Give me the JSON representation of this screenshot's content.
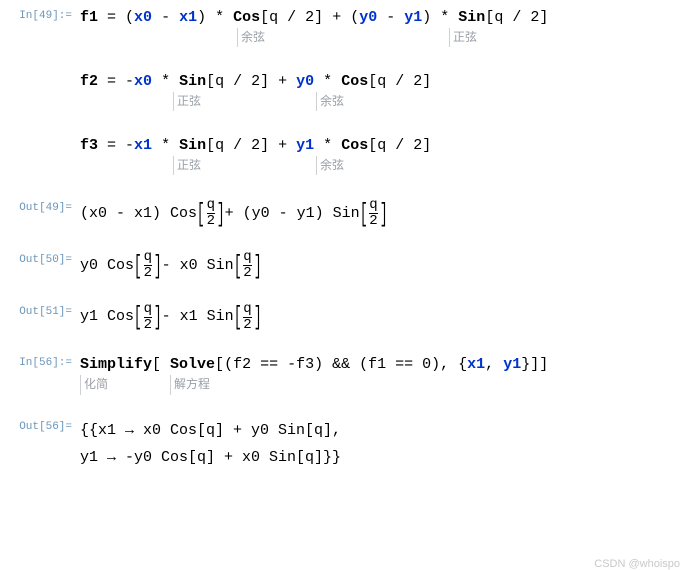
{
  "labels": {
    "in49": "In[49]:=",
    "out49": "Out[49]=",
    "out50": "Out[50]=",
    "out51": "Out[51]=",
    "in56": "In[56]:=",
    "out56": "Out[56]="
  },
  "anns": {
    "cos": "余弦",
    "sin": "正弦",
    "simplify": "化简",
    "solve": "解方程"
  },
  "code": {
    "f1_lhs": "f1",
    "f2_lhs": "f2",
    "f3_lhs": "f3",
    "eq": " = ",
    "mul": " * ",
    "plus": " + ",
    "minus": " - ",
    "neg": "-",
    "lpar": "(",
    "rpar": ")",
    "x0": "x0",
    "x1": "x1",
    "y0": "y0",
    "y1": "y1",
    "cos": "Cos",
    "sin": "Sin",
    "lbrk": "[",
    "rbrk": "]",
    "qhalf": "q / 2",
    "simplify": "Simplify",
    "solve": "Solve",
    "solve_arg_open": "[ ",
    "solve_arg_close": "]",
    "f2eqnegf3": "(f2 == -f3)",
    "andand": " && ",
    "f1eq0": "(f1 == 0)",
    "comma": ", ",
    "vars_open": "{",
    "vars_close": "}",
    "simp_close": "]"
  },
  "out": {
    "o49_a": "(x0 - x1) Cos",
    "o49_b": " + (y0 - y1) Sin",
    "o50_a": "y0 Cos",
    "o50_b": " - x0 Sin",
    "o51_a": "y1 Cos",
    "o51_b": " - x1 Sin",
    "q": "q",
    "two": "2",
    "o56_l1": "{{x1 → x0 Cos[q] + y0 Sin[q],",
    "o56_l2": "  y1 → -y0 Cos[q] + x0 Sin[q]}}"
  },
  "watermark": "CSDN @whoispo"
}
